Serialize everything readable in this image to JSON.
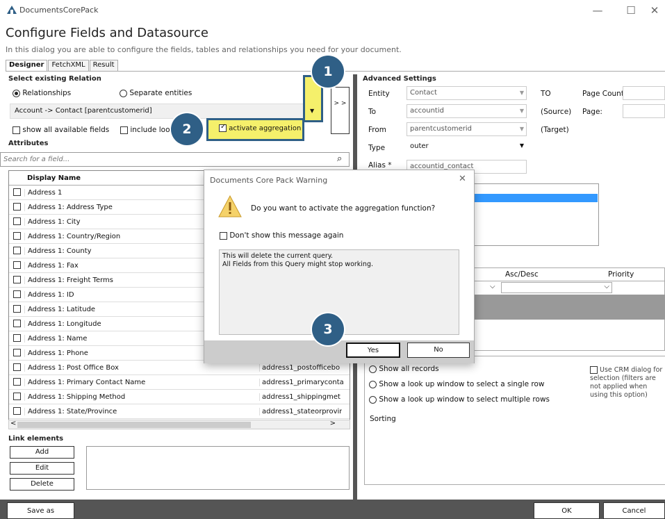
{
  "window": {
    "title": "DocumentsCorePack",
    "min": "—",
    "max": "☐",
    "close": "✕"
  },
  "header": {
    "title": "Configure Fields and Datasource",
    "subtitle": "In this dialog you are able to configure the fields, tables and relationships you need for your document."
  },
  "tabs": [
    "Designer",
    "FetchXML",
    "Result"
  ],
  "relation": {
    "group": "Select existing Relation",
    "radio1": "Relationships",
    "radio2": "Separate entities",
    "selected": "Account -> Contact   [parentcustomerid]",
    "arrow_btn": "> >",
    "chk_all": "show all available fields",
    "chk_lookup": "include lookups",
    "chk_agg": "activate aggregation"
  },
  "attributes": {
    "group": "Attributes",
    "search_placeholder": "Search for a field...",
    "col_display": "Display Name",
    "rows": [
      {
        "name": "Address 1",
        "field": ""
      },
      {
        "name": "Address 1: Address Type",
        "field": ""
      },
      {
        "name": "Address 1: City",
        "field": ""
      },
      {
        "name": "Address 1: Country/Region",
        "field": ""
      },
      {
        "name": "Address 1: County",
        "field": ""
      },
      {
        "name": "Address 1: Fax",
        "field": ""
      },
      {
        "name": "Address 1: Freight Terms",
        "field": ""
      },
      {
        "name": "Address 1: ID",
        "field": ""
      },
      {
        "name": "Address 1: Latitude",
        "field": ""
      },
      {
        "name": "Address 1: Longitude",
        "field": ""
      },
      {
        "name": "Address 1: Name",
        "field": ""
      },
      {
        "name": "Address 1: Phone",
        "field": ""
      },
      {
        "name": "Address 1: Post Office Box",
        "field": "address1_postofficebo"
      },
      {
        "name": "Address 1: Primary Contact Name",
        "field": "address1_primaryconta"
      },
      {
        "name": "Address 1: Shipping Method",
        "field": "address1_shippingmet"
      },
      {
        "name": "Address 1: State/Province",
        "field": "address1_stateorprovir"
      }
    ]
  },
  "link": {
    "group": "Link elements",
    "add": "Add",
    "edit": "Edit",
    "delete": "Delete"
  },
  "advanced": {
    "group": "Advanced Settings",
    "entity_label": "Entity",
    "entity": "Contact",
    "to_label": "To",
    "to": "accountid",
    "from_label": "From",
    "from": "parentcustomerid",
    "type_label": "Type",
    "type": "outer",
    "alias_label": "Alias *",
    "alias": "accountid_contact",
    "TO": "TO",
    "source": "(Source)",
    "target": "(Target)",
    "page_count": "Page Count:",
    "page": "Page:"
  },
  "sort": {
    "asc_desc": "Asc/Desc",
    "priority": "Priority",
    "sorting": "Sorting"
  },
  "records": {
    "all": "Show all records",
    "single": "Show a look up window to select a single row",
    "multi": "Show a look up window to select multiple rows",
    "crm": "Use CRM dialog for selection (filters are not applied when using this option)"
  },
  "dialog": {
    "title": "Documents Core Pack Warning",
    "message": "Do you want to activate the aggregation function?",
    "dont_show": "Don't show this message again",
    "detail1": "This will delete the current query.",
    "detail2": "All Fields from this Query might stop working.",
    "yes": "Yes",
    "no": "No"
  },
  "badges": [
    "1",
    "2",
    "3"
  ],
  "footer": {
    "save_as": "Save as",
    "ok": "OK",
    "cancel": "Cancel"
  },
  "colors": {
    "badge": "#2f5f86",
    "highlight": "#f5f06b",
    "selection": "#3399ff"
  }
}
